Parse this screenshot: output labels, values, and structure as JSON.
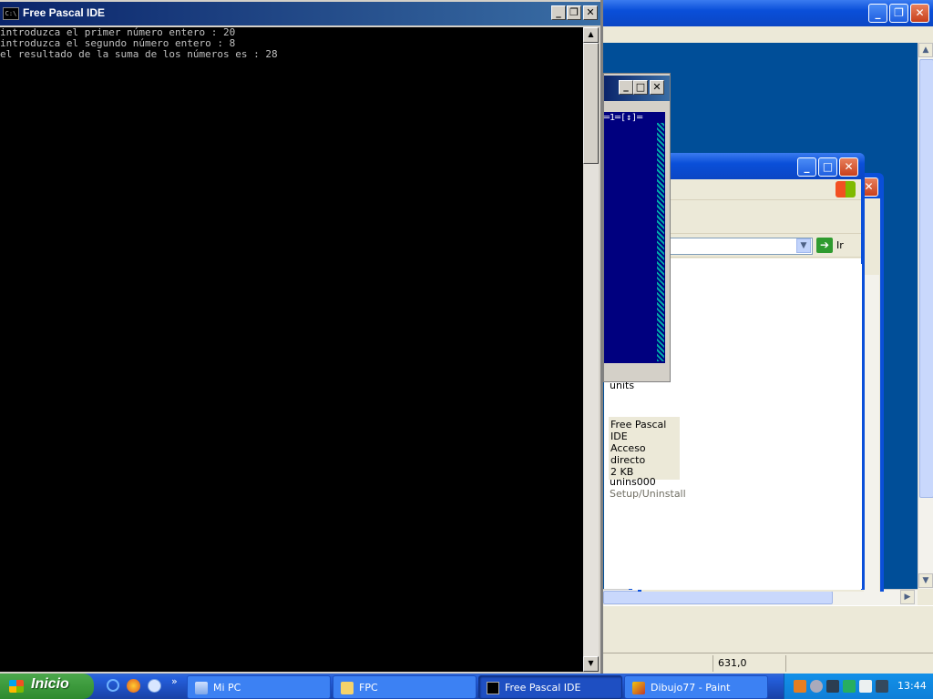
{
  "console": {
    "title": "Free Pascal IDE",
    "icon_label": "C:\\",
    "lines": [
      "introduzca el primer número entero : 20",
      "introduzca el segundo número entero : 8",
      "el resultado de la suma de los números es : 28"
    ]
  },
  "ide_window": {
    "status_line": "═1═[↕]═"
  },
  "explorer": {
    "go_label": "Ir",
    "files": [
      {
        "name": "units",
        "detail": []
      },
      {
        "name": "Free Pascal IDE",
        "detail": [
          "Acceso directo",
          "2 KB"
        ]
      },
      {
        "name": "unins000",
        "detail": [
          "Setup/Uninstall"
        ]
      }
    ]
  },
  "paint": {
    "coords": "631,0"
  },
  "taskbar": {
    "start_label": "Inicio",
    "tasks": [
      "Mi PC",
      "FPC",
      "Free Pascal IDE",
      "Dibujo77 - Paint"
    ],
    "active_task": "Free Pascal IDE",
    "clock": "13:44"
  },
  "colors": {
    "desktop": "#004e98",
    "taskbar": "#245edb",
    "start": "#3c9a3c",
    "console_bg": "#000000",
    "console_fg": "#c0c0c0",
    "ide_blue": "#00007f"
  }
}
